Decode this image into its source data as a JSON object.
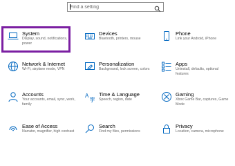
{
  "search": {
    "placeholder": "Find a setting"
  },
  "accent_color": "#0067c0",
  "highlight_color": "#7b1fa2",
  "tiles": [
    {
      "title": "System",
      "desc": "Display, sound, notifications, power",
      "icon": "laptop-icon"
    },
    {
      "title": "Devices",
      "desc": "Bluetooth, printers, mouse",
      "icon": "keyboard-icon"
    },
    {
      "title": "Phone",
      "desc": "Link your Android, iPhone",
      "icon": "phone-icon"
    },
    {
      "title": "Network & Internet",
      "desc": "Wi-Fi, airplane mode, VPN",
      "icon": "globe-icon"
    },
    {
      "title": "Personalization",
      "desc": "Background, lock screen, colors",
      "icon": "paint-icon"
    },
    {
      "title": "Apps",
      "desc": "Uninstall, defaults, optional features",
      "icon": "apps-list-icon"
    },
    {
      "title": "Accounts",
      "desc": "Your accounts, email, sync, work, family",
      "icon": "person-icon"
    },
    {
      "title": "Time & Language",
      "desc": "Speech, region, date",
      "icon": "time-language-icon"
    },
    {
      "title": "Gaming",
      "desc": "Xbox Game Bar, captures, Game Mode",
      "icon": "xbox-icon"
    },
    {
      "title": "Ease of Access",
      "desc": "Narrator, magnifier, high contrast",
      "icon": "ease-of-access-icon"
    },
    {
      "title": "Search",
      "desc": "Find my files, permissions",
      "icon": "search-icon"
    },
    {
      "title": "Privacy",
      "desc": "Location, camera, microphone",
      "icon": "lock-icon"
    }
  ]
}
